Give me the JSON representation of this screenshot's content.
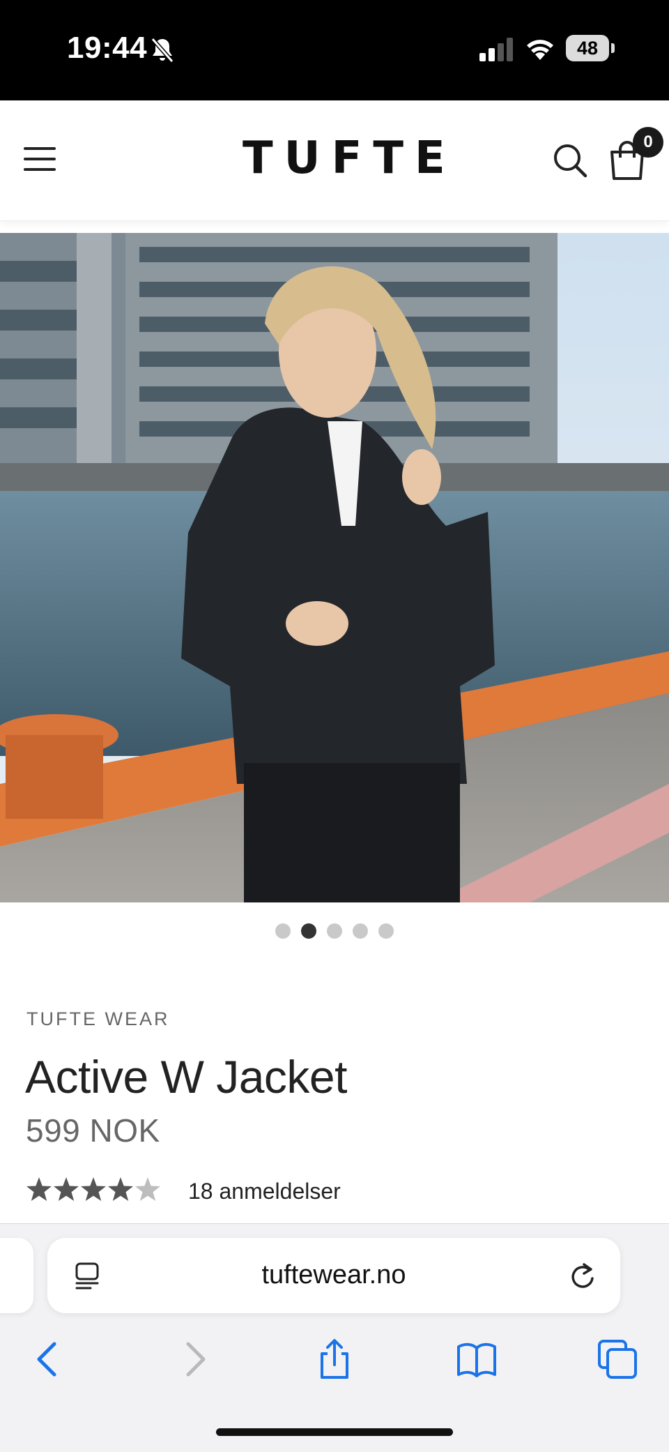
{
  "status_bar": {
    "time": "19:44",
    "battery": "48",
    "icons": [
      "bell-slash-icon",
      "cellular-signal-icon",
      "wifi-icon",
      "battery-icon"
    ]
  },
  "header": {
    "logo": "TUFTE",
    "cart_count": "0",
    "icons": [
      "hamburger-menu-icon",
      "search-icon",
      "shopping-bag-icon"
    ]
  },
  "product": {
    "image_alt": "",
    "carousel": {
      "total": 5,
      "active_index": 1
    },
    "brand": "TUFTE WEAR",
    "title": "Active W Jacket",
    "price": "599 NOK",
    "rating": 4.5,
    "rating_max": 5,
    "reviews": "18 anmeldelser"
  },
  "browser": {
    "url": "tuftewear.no",
    "accent": "#1a73e8",
    "icons": [
      "reader-mode-icon",
      "reload-icon",
      "back-icon",
      "forward-icon",
      "share-icon",
      "bookmarks-icon",
      "tabs-icon"
    ]
  }
}
